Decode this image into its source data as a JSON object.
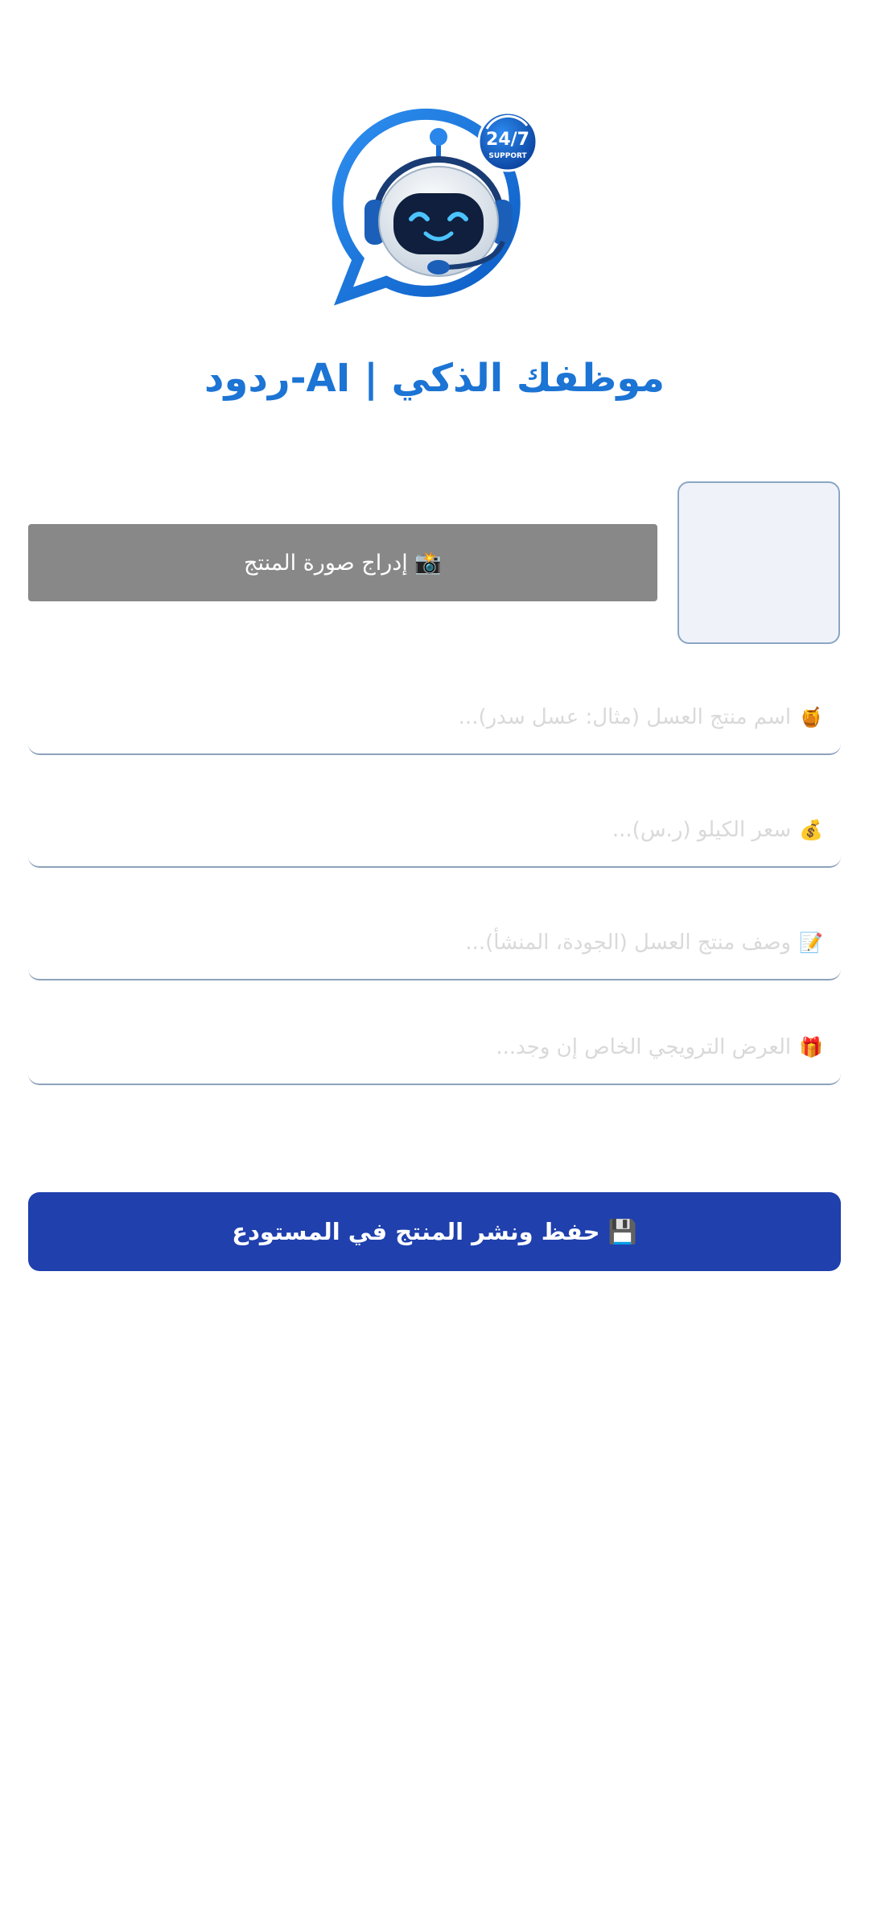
{
  "app": {
    "title": "ردود-AI | موظفك الذكي"
  },
  "logo": {
    "badge_main": "24/7",
    "badge_sub": "SUPPORT"
  },
  "upload": {
    "label": "📸 إدراج صورة المنتج"
  },
  "form": {
    "name": {
      "emoji": "🍯",
      "placeholder": "اسم منتج العسل (مثال: عسل سدر)..."
    },
    "price": {
      "emoji": "💰",
      "placeholder": "سعر الكيلو (ر.س)..."
    },
    "description": {
      "emoji": "📝",
      "placeholder": "وصف منتج العسل (الجودة، المنشأ)..."
    },
    "promo": {
      "emoji": "🎁",
      "placeholder": "العرض الترويجي الخاص إن وجد..."
    }
  },
  "actions": {
    "save_label": "💾 حفظ ونشر المنتج في المستودع"
  },
  "colors": {
    "brand_blue": "#1c74d4",
    "save_button": "#1f40ad",
    "upload_button": "#888888",
    "preview_bg": "#eff3f9"
  }
}
